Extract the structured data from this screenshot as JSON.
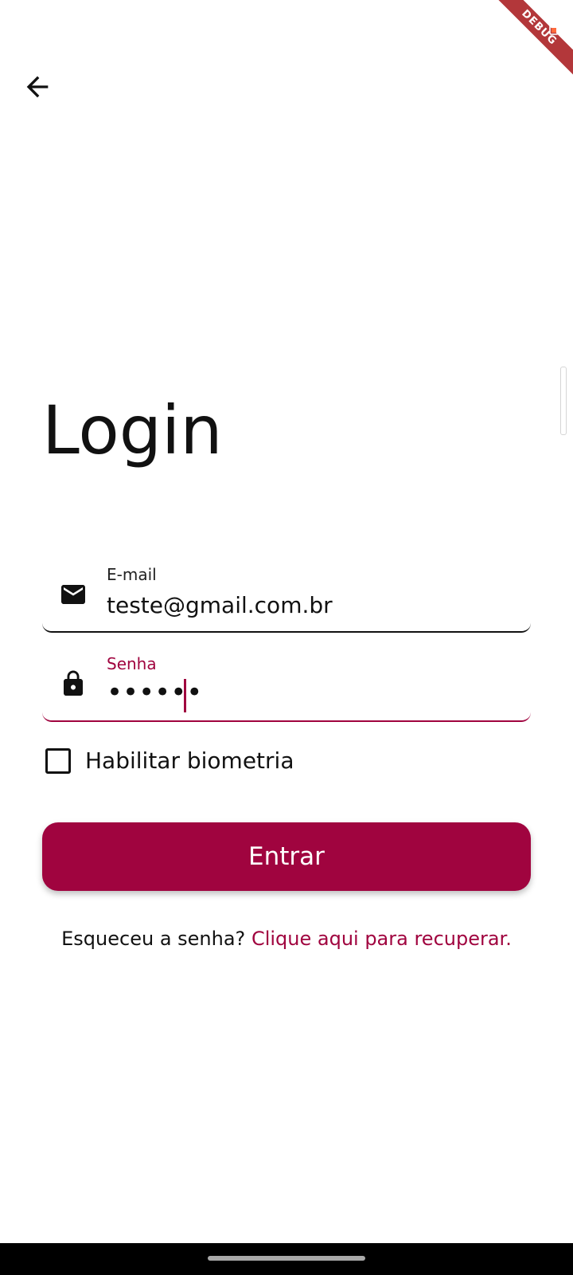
{
  "app_bar": {
    "back_icon": "arrow-back-icon",
    "debug_banner": "DEBUG"
  },
  "page": {
    "title": "Login"
  },
  "form": {
    "email": {
      "label": "E-mail",
      "value": "teste@gmail.com.br",
      "icon": "mail-icon"
    },
    "password": {
      "label": "Senha",
      "value": "••••••",
      "icon": "lock-icon"
    },
    "biometric": {
      "label": "Habilitar biometria",
      "checked": false
    },
    "submit_label": "Entrar"
  },
  "forgot": {
    "prompt": "Esqueceu a senha?",
    "link": "Clique aqui para recuperar."
  },
  "colors": {
    "accent": "#a0043f",
    "text": "#111111",
    "background": "#ffffff",
    "debug_banner": "#b3373a"
  }
}
